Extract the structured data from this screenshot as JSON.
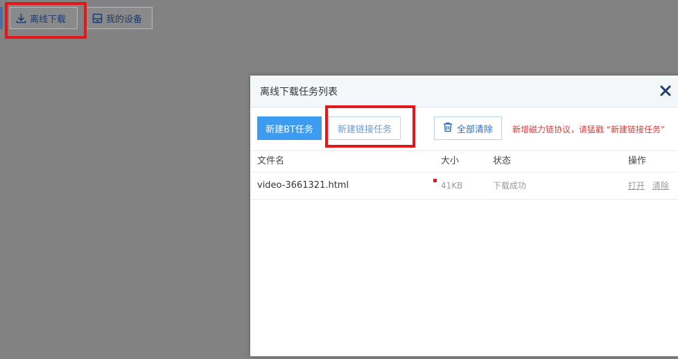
{
  "top_bar": {
    "offline_download_label": "离线下载",
    "my_devices_label": "我的设备"
  },
  "modal": {
    "title": "离线下载任务列表",
    "close_icon": "close-icon",
    "toolbar": {
      "new_bt_label": "新建BT任务",
      "new_link_label": "新建链接任务",
      "clear_all_label": "全部清除",
      "hint": "新增磁力链协议，请猛戳 “新建链接任务”"
    },
    "columns": [
      "文件名",
      "大小",
      "状态",
      "操作"
    ],
    "rows": [
      {
        "name": "video-3661321.html",
        "size": "41KB",
        "status": "下载成功",
        "action_open": "打开",
        "action_clear": "清除"
      }
    ]
  },
  "colors": {
    "primary": "#3d9bf0",
    "highlight": "#e3161b",
    "hint": "#e23a3a",
    "overlay": "#828282"
  }
}
